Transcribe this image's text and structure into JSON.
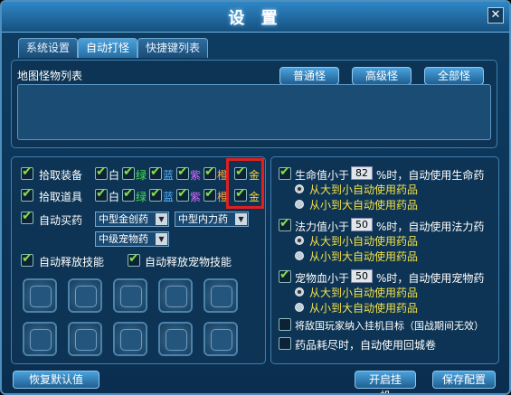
{
  "window": {
    "title": "设 置",
    "close": "✕"
  },
  "tabs": [
    {
      "label": "系统设置"
    },
    {
      "label": "自动打怪"
    },
    {
      "label": "快捷键列表"
    }
  ],
  "monster_list": {
    "label": "地图怪物列表",
    "buttons": [
      "普通怪",
      "高级怪",
      "全部怪"
    ]
  },
  "pickup": {
    "equip_label": "拾取装备",
    "item_label": "拾取道具",
    "colors": [
      "白",
      "绿",
      "蓝",
      "紫",
      "橙",
      "金"
    ],
    "auto_buy_label": "自动买药",
    "dropdowns": [
      "中型金创药",
      "中型内力药",
      "中级宠物药"
    ],
    "skill_label": "自动释放技能",
    "pet_skill_label": "自动释放宠物技能"
  },
  "hp": {
    "prefix": "生命值小于",
    "value": "82",
    "suffix": "%时，自动使用生命药",
    "opt1": "从大到小自动使用药品",
    "opt2": "从小到大自动使用药品"
  },
  "mp": {
    "prefix": "法力值小于",
    "value": "50",
    "suffix": "%时，自动使用法力药",
    "opt1": "从大到小自动使用药品",
    "opt2": "从小到大自动使用药品"
  },
  "pet": {
    "prefix": "宠物血小于",
    "value": "50",
    "suffix": "%时，自动使用宠物药",
    "opt1": "从大到小自动使用药品",
    "opt2": "从小到大自动使用药品"
  },
  "enemy_label": "将敌国玩家纳入挂机目标（国战期间无效）",
  "return_label": "药品耗尽时，自动使用回城卷",
  "footer": {
    "reset": "恢复默认值",
    "start": "开启挂机",
    "save": "保存配置"
  }
}
